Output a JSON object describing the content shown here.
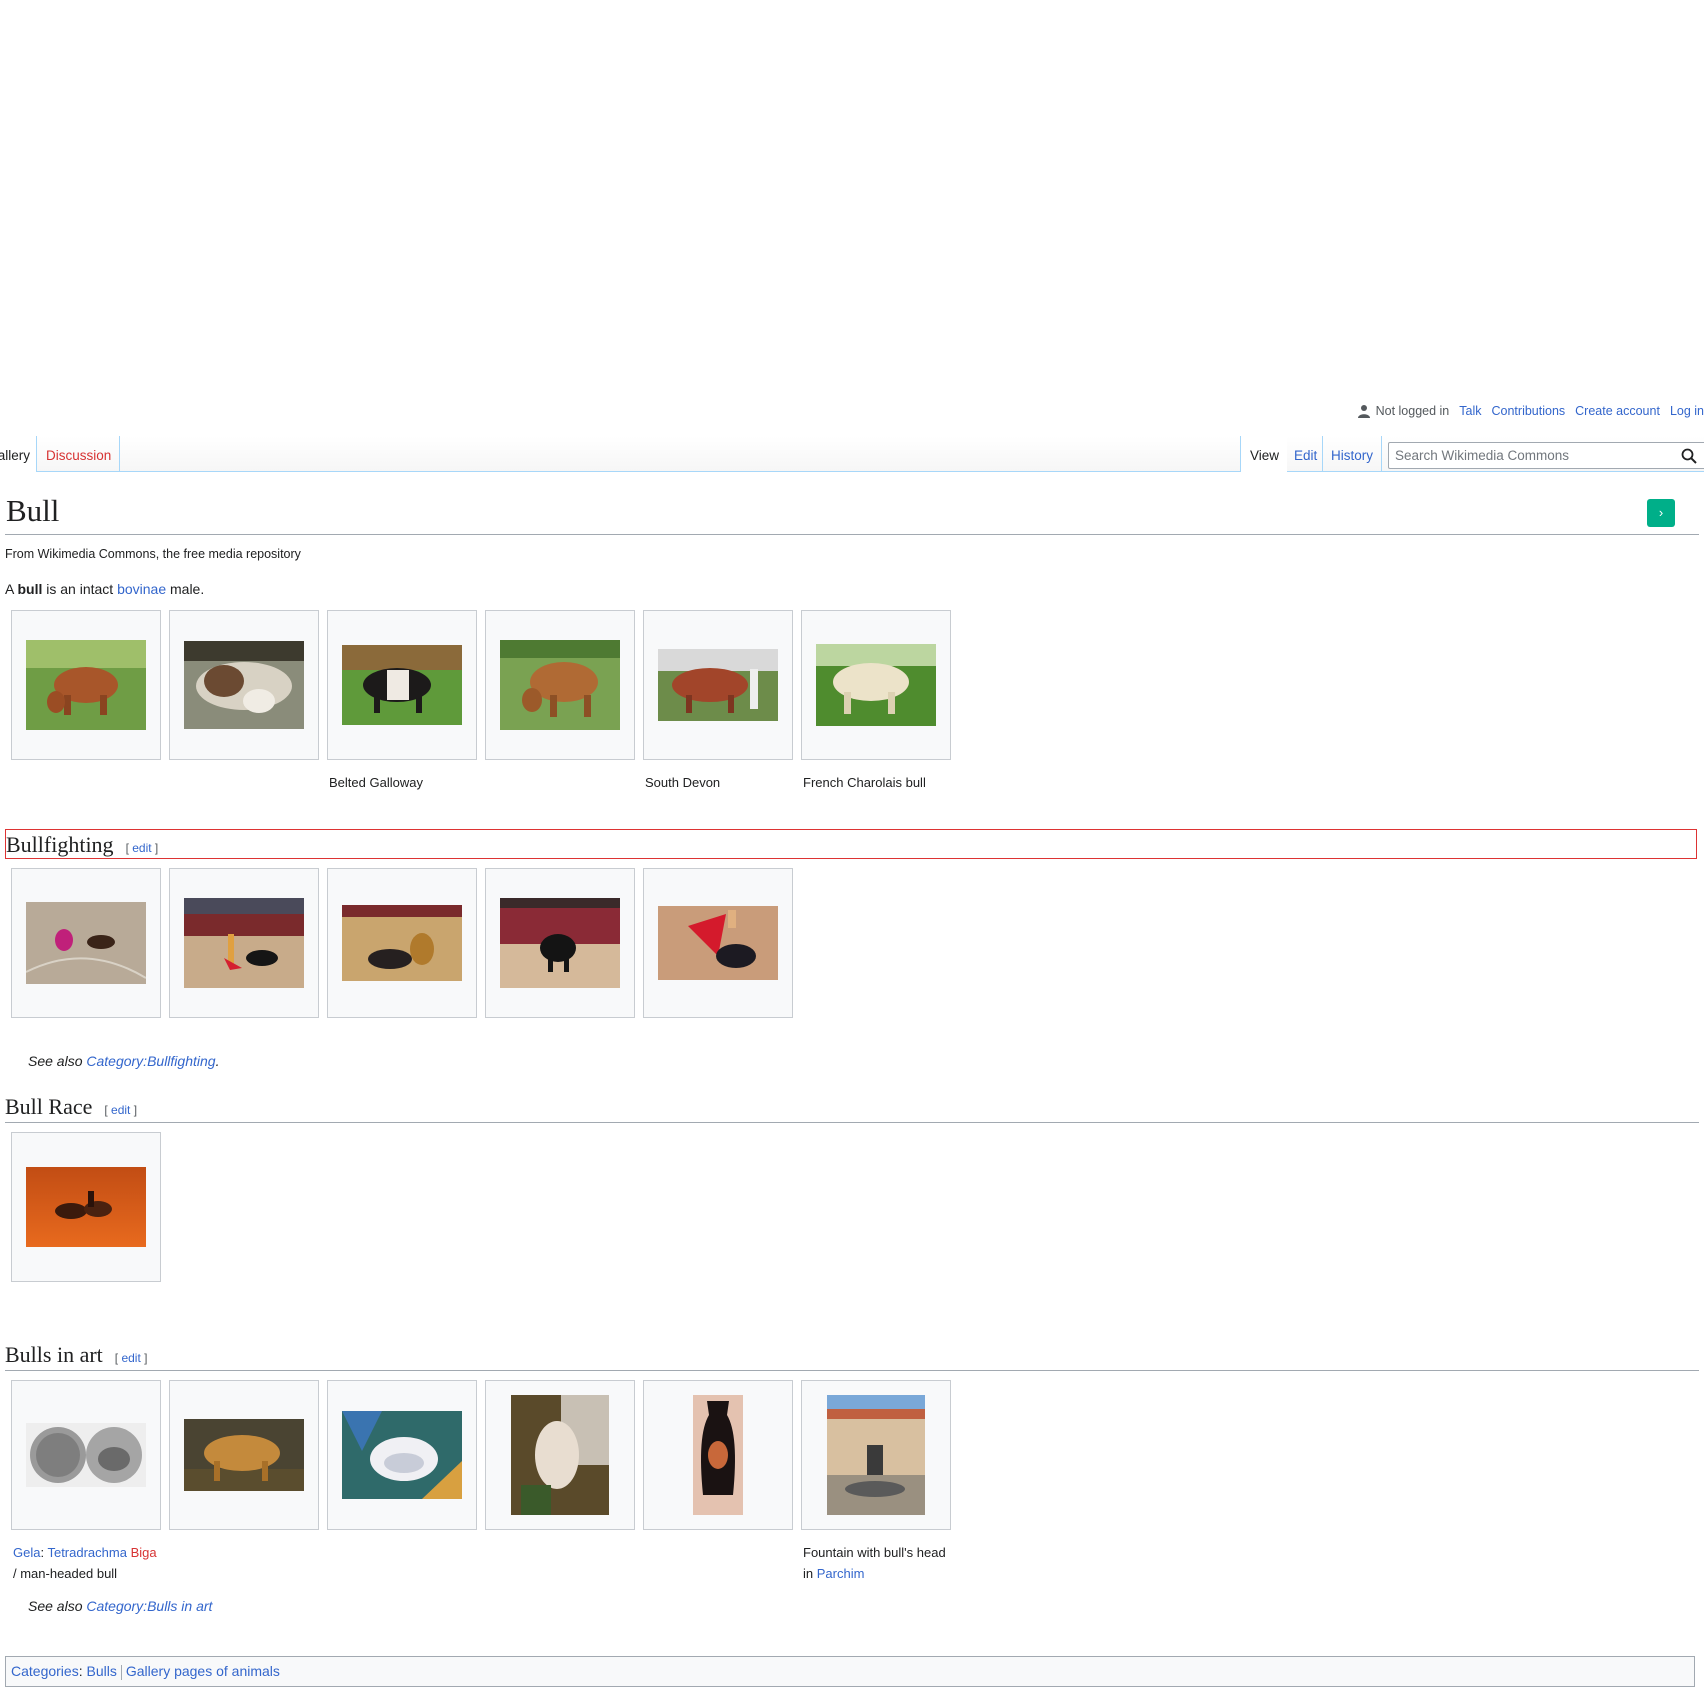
{
  "personal_tools": {
    "not_logged_in": "Not logged in",
    "talk": "Talk",
    "contributions": "Contributions",
    "create_account": "Create account",
    "log_in": "Log in"
  },
  "tabs": {
    "gallery": "Gallery",
    "discussion": "Discussion",
    "view": "View",
    "edit": "Edit",
    "history": "History"
  },
  "search": {
    "placeholder": "Search Wikimedia Commons"
  },
  "page": {
    "title": "Bull",
    "tagline": "From Wikimedia Commons, the free media repository",
    "intro_a": "A ",
    "intro_bold": "bull",
    "intro_mid": " is an intact ",
    "intro_link": "bovinae",
    "intro_end": " male."
  },
  "gallery_main": {
    "captions": [
      "",
      "",
      "Belted Galloway",
      "",
      "South Devon",
      "French Charolais bull"
    ]
  },
  "sections": {
    "bullfighting": {
      "heading": "Bullfighting",
      "edit": "edit",
      "see_also_prefix": "See also ",
      "see_also_link": "Category:Bullfighting",
      "see_also_suffix": "."
    },
    "bull_race": {
      "heading": "Bull Race",
      "edit": "edit"
    },
    "bulls_in_art": {
      "heading": "Bulls in art",
      "edit": "edit",
      "caption1_link1": "Gela",
      "caption1_sep": ": ",
      "caption1_link2": "Tetradrachma",
      "caption1_link3": "Biga",
      "caption1_rest": "/ man-headed bull",
      "caption6_text": "Fountain with bull's head in ",
      "caption6_link": "Parchim",
      "see_also_prefix": "See also ",
      "see_also_link": "Category:Bulls in art"
    }
  },
  "categories": {
    "label": "Categories",
    "colon": ": ",
    "items": [
      "Bulls",
      "Gallery pages of animals"
    ]
  },
  "colors": {
    "link": "#3366cc",
    "redlink": "#d73333",
    "highlight_border": "#dd3333",
    "go_button": "#00af89"
  }
}
